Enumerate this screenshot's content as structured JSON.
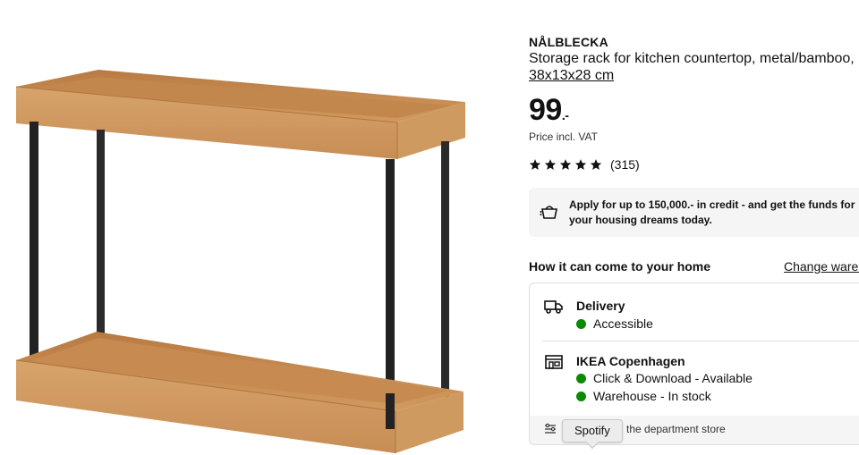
{
  "product": {
    "name": "NÅLBLECKA",
    "description": "Storage rack for kitchen countertop, metal/bamboo,",
    "size": "38x13x28 cm",
    "price_main": "99",
    "price_suffix": ".-",
    "price_note": "Price incl. VAT",
    "rating_value": 5,
    "rating_count": "(315)",
    "image_icon": "bamboo-rack-photo"
  },
  "credit": {
    "text": "Apply for up to 150,000.- in credit - and get the funds for your housing dreams today.",
    "icon": "credit-bag-icon"
  },
  "delivery": {
    "heading": "How it can come to your home",
    "change_link": "Change wareh"
  },
  "availability": {
    "delivery_title": "Delivery",
    "delivery_status": "Accessible",
    "store_title": "IKEA Copenhagen",
    "store_status_1": "Click & Download - Available",
    "store_status_2": "Warehouse - In stock",
    "footer_text": "the department store",
    "status_color": "#0a8a00"
  },
  "tooltip": {
    "text": "Spotify"
  }
}
